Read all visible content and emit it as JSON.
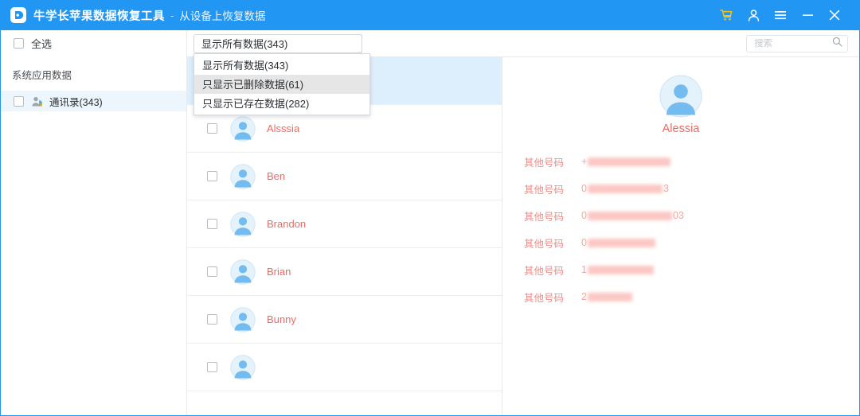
{
  "titlebar": {
    "app_name": "牛学长苹果数据恢复工具",
    "separator": "-",
    "subtitle": "从设备上恢复数据",
    "background_color": "#2196f3",
    "logo_icon": "app-logo-icon",
    "buttons": [
      {
        "name": "cart-icon",
        "label": "购物车",
        "color": "#ffc107"
      },
      {
        "name": "account-icon",
        "label": "账户",
        "color": "#ffffff"
      },
      {
        "name": "menu-icon",
        "label": "菜单",
        "color": "#ffffff"
      },
      {
        "name": "minimize-icon",
        "label": "最小化",
        "color": "#ffffff"
      },
      {
        "name": "close-icon",
        "label": "关闭",
        "color": "#ffffff"
      }
    ]
  },
  "toolbar": {
    "select_all_label": "全选",
    "filter": {
      "selected": "显示所有数据(343)",
      "options": [
        {
          "label": "显示所有数据(343)",
          "hovered": false
        },
        {
          "label": "只显示已删除数据(61)",
          "hovered": true
        },
        {
          "label": "只显示已存在数据(282)",
          "hovered": false
        }
      ]
    },
    "search": {
      "placeholder": "搜索",
      "value": "",
      "icon": "search-icon"
    }
  },
  "sidebar": {
    "section_title": "系统应用数据",
    "items": [
      {
        "label": "通讯录(343)",
        "icon": "contacts-icon",
        "checked": false,
        "selected": true
      }
    ]
  },
  "list": {
    "contacts": [
      {
        "name": "Alessia",
        "checked": false,
        "selected": true
      },
      {
        "name": "Alsssia",
        "checked": false,
        "selected": false
      },
      {
        "name": "Ben",
        "checked": false,
        "selected": false
      },
      {
        "name": "Brandon",
        "checked": false,
        "selected": false
      },
      {
        "name": "Brian",
        "checked": false,
        "selected": false
      },
      {
        "name": "Bunny",
        "checked": false,
        "selected": false
      },
      {
        "name": "",
        "checked": false,
        "selected": false
      }
    ],
    "name_color": "#ec6a65",
    "selected_row_color": "#ddeefc"
  },
  "detail": {
    "name": "Alessia",
    "avatar_icon": "person-avatar-icon",
    "fields": [
      {
        "label": "其他号码",
        "prefix": "+",
        "suffix": "",
        "redacted_width": 104
      },
      {
        "label": "其他号码",
        "prefix": "0",
        "suffix": "3",
        "redacted_width": 94
      },
      {
        "label": "其他号码",
        "prefix": "0",
        "suffix": "03",
        "redacted_width": 106
      },
      {
        "label": "其他号码",
        "prefix": "0",
        "suffix": "",
        "redacted_width": 85
      },
      {
        "label": "其他号码",
        "prefix": "1",
        "suffix": "",
        "redacted_width": 83
      },
      {
        "label": "其他号码",
        "prefix": "2",
        "suffix": "",
        "redacted_width": 56
      }
    ]
  }
}
